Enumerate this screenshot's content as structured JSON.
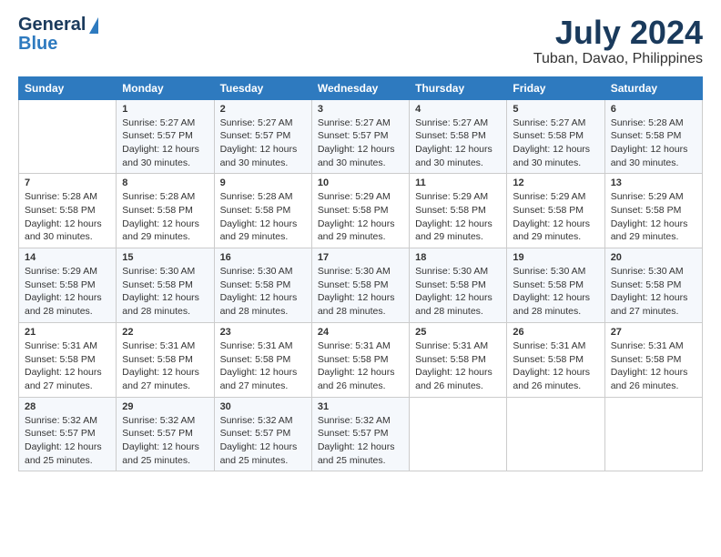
{
  "logo": {
    "line1": "General",
    "line2": "Blue"
  },
  "title": "July 2024",
  "subtitle": "Tuban, Davao, Philippines",
  "days_header": [
    "Sunday",
    "Monday",
    "Tuesday",
    "Wednesday",
    "Thursday",
    "Friday",
    "Saturday"
  ],
  "weeks": [
    {
      "cells": [
        {
          "day": "",
          "content": ""
        },
        {
          "day": "1",
          "content": "Sunrise: 5:27 AM\nSunset: 5:57 PM\nDaylight: 12 hours\nand 30 minutes."
        },
        {
          "day": "2",
          "content": "Sunrise: 5:27 AM\nSunset: 5:57 PM\nDaylight: 12 hours\nand 30 minutes."
        },
        {
          "day": "3",
          "content": "Sunrise: 5:27 AM\nSunset: 5:57 PM\nDaylight: 12 hours\nand 30 minutes."
        },
        {
          "day": "4",
          "content": "Sunrise: 5:27 AM\nSunset: 5:58 PM\nDaylight: 12 hours\nand 30 minutes."
        },
        {
          "day": "5",
          "content": "Sunrise: 5:27 AM\nSunset: 5:58 PM\nDaylight: 12 hours\nand 30 minutes."
        },
        {
          "day": "6",
          "content": "Sunrise: 5:28 AM\nSunset: 5:58 PM\nDaylight: 12 hours\nand 30 minutes."
        }
      ]
    },
    {
      "cells": [
        {
          "day": "7",
          "content": "Sunrise: 5:28 AM\nSunset: 5:58 PM\nDaylight: 12 hours\nand 30 minutes."
        },
        {
          "day": "8",
          "content": "Sunrise: 5:28 AM\nSunset: 5:58 PM\nDaylight: 12 hours\nand 29 minutes."
        },
        {
          "day": "9",
          "content": "Sunrise: 5:28 AM\nSunset: 5:58 PM\nDaylight: 12 hours\nand 29 minutes."
        },
        {
          "day": "10",
          "content": "Sunrise: 5:29 AM\nSunset: 5:58 PM\nDaylight: 12 hours\nand 29 minutes."
        },
        {
          "day": "11",
          "content": "Sunrise: 5:29 AM\nSunset: 5:58 PM\nDaylight: 12 hours\nand 29 minutes."
        },
        {
          "day": "12",
          "content": "Sunrise: 5:29 AM\nSunset: 5:58 PM\nDaylight: 12 hours\nand 29 minutes."
        },
        {
          "day": "13",
          "content": "Sunrise: 5:29 AM\nSunset: 5:58 PM\nDaylight: 12 hours\nand 29 minutes."
        }
      ]
    },
    {
      "cells": [
        {
          "day": "14",
          "content": "Sunrise: 5:29 AM\nSunset: 5:58 PM\nDaylight: 12 hours\nand 28 minutes."
        },
        {
          "day": "15",
          "content": "Sunrise: 5:30 AM\nSunset: 5:58 PM\nDaylight: 12 hours\nand 28 minutes."
        },
        {
          "day": "16",
          "content": "Sunrise: 5:30 AM\nSunset: 5:58 PM\nDaylight: 12 hours\nand 28 minutes."
        },
        {
          "day": "17",
          "content": "Sunrise: 5:30 AM\nSunset: 5:58 PM\nDaylight: 12 hours\nand 28 minutes."
        },
        {
          "day": "18",
          "content": "Sunrise: 5:30 AM\nSunset: 5:58 PM\nDaylight: 12 hours\nand 28 minutes."
        },
        {
          "day": "19",
          "content": "Sunrise: 5:30 AM\nSunset: 5:58 PM\nDaylight: 12 hours\nand 28 minutes."
        },
        {
          "day": "20",
          "content": "Sunrise: 5:30 AM\nSunset: 5:58 PM\nDaylight: 12 hours\nand 27 minutes."
        }
      ]
    },
    {
      "cells": [
        {
          "day": "21",
          "content": "Sunrise: 5:31 AM\nSunset: 5:58 PM\nDaylight: 12 hours\nand 27 minutes."
        },
        {
          "day": "22",
          "content": "Sunrise: 5:31 AM\nSunset: 5:58 PM\nDaylight: 12 hours\nand 27 minutes."
        },
        {
          "day": "23",
          "content": "Sunrise: 5:31 AM\nSunset: 5:58 PM\nDaylight: 12 hours\nand 27 minutes."
        },
        {
          "day": "24",
          "content": "Sunrise: 5:31 AM\nSunset: 5:58 PM\nDaylight: 12 hours\nand 26 minutes."
        },
        {
          "day": "25",
          "content": "Sunrise: 5:31 AM\nSunset: 5:58 PM\nDaylight: 12 hours\nand 26 minutes."
        },
        {
          "day": "26",
          "content": "Sunrise: 5:31 AM\nSunset: 5:58 PM\nDaylight: 12 hours\nand 26 minutes."
        },
        {
          "day": "27",
          "content": "Sunrise: 5:31 AM\nSunset: 5:58 PM\nDaylight: 12 hours\nand 26 minutes."
        }
      ]
    },
    {
      "cells": [
        {
          "day": "28",
          "content": "Sunrise: 5:32 AM\nSunset: 5:57 PM\nDaylight: 12 hours\nand 25 minutes."
        },
        {
          "day": "29",
          "content": "Sunrise: 5:32 AM\nSunset: 5:57 PM\nDaylight: 12 hours\nand 25 minutes."
        },
        {
          "day": "30",
          "content": "Sunrise: 5:32 AM\nSunset: 5:57 PM\nDaylight: 12 hours\nand 25 minutes."
        },
        {
          "day": "31",
          "content": "Sunrise: 5:32 AM\nSunset: 5:57 PM\nDaylight: 12 hours\nand 25 minutes."
        },
        {
          "day": "",
          "content": ""
        },
        {
          "day": "",
          "content": ""
        },
        {
          "day": "",
          "content": ""
        }
      ]
    }
  ]
}
